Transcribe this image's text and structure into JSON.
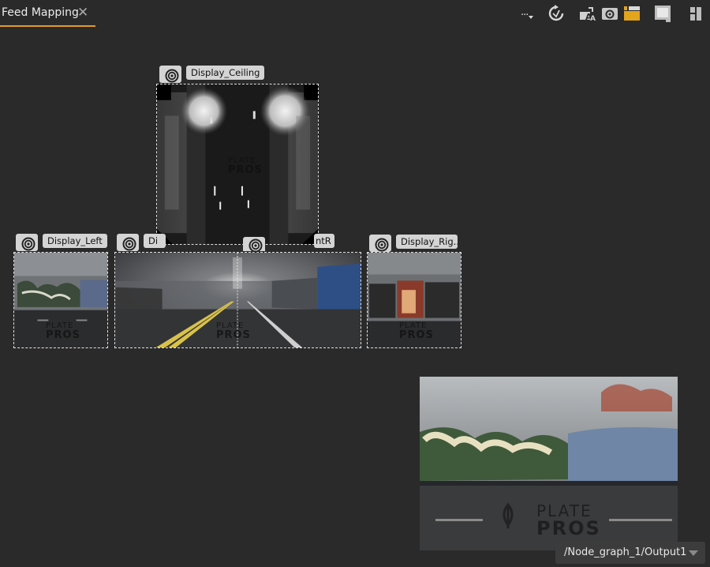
{
  "tab": {
    "label": "Feed Mapping",
    "close": "✕"
  },
  "toolbar": {
    "more": "...",
    "icons": [
      "refresh-icon",
      "text-overlay-icon",
      "camera-feed-icon",
      "clapper-icon",
      "screen-icon",
      "layout-icon"
    ],
    "accent": "#e39a2b"
  },
  "nodes": {
    "ceiling": {
      "label": "Display_Ceiling"
    },
    "left": {
      "label": "Display_Left"
    },
    "front_l": {
      "label": "Di"
    },
    "front_r": {
      "label": "ntR"
    },
    "right": {
      "label": "Display_Rig..."
    }
  },
  "watermark": {
    "line1": "PLATE",
    "line2": "PROS"
  },
  "output": {
    "path": "/Node_graph_1/Output1"
  }
}
